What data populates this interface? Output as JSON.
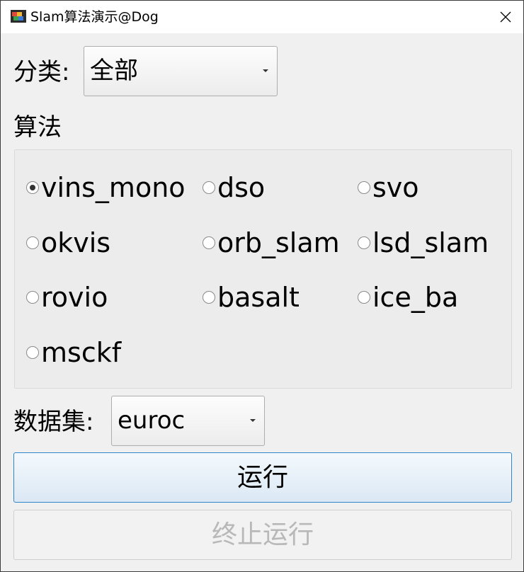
{
  "window": {
    "title": "Slam算法演示@Dog",
    "icons": {
      "app": "app-icon",
      "close": "close-icon"
    }
  },
  "category": {
    "label": "分类:",
    "selected": "全部"
  },
  "algorithms": {
    "heading": "算法",
    "options": [
      {
        "label": "vins_mono",
        "checked": true
      },
      {
        "label": "dso",
        "checked": false
      },
      {
        "label": "svo",
        "checked": false
      },
      {
        "label": "okvis",
        "checked": false
      },
      {
        "label": "orb_slam",
        "checked": false
      },
      {
        "label": "lsd_slam",
        "checked": false
      },
      {
        "label": "rovio",
        "checked": false
      },
      {
        "label": "basalt",
        "checked": false
      },
      {
        "label": "ice_ba",
        "checked": false
      },
      {
        "label": "msckf",
        "checked": false
      }
    ]
  },
  "dataset": {
    "label": "数据集:",
    "selected": "euroc"
  },
  "actions": {
    "run_label": "运行",
    "stop_label": "终止运行",
    "stop_enabled": false
  }
}
